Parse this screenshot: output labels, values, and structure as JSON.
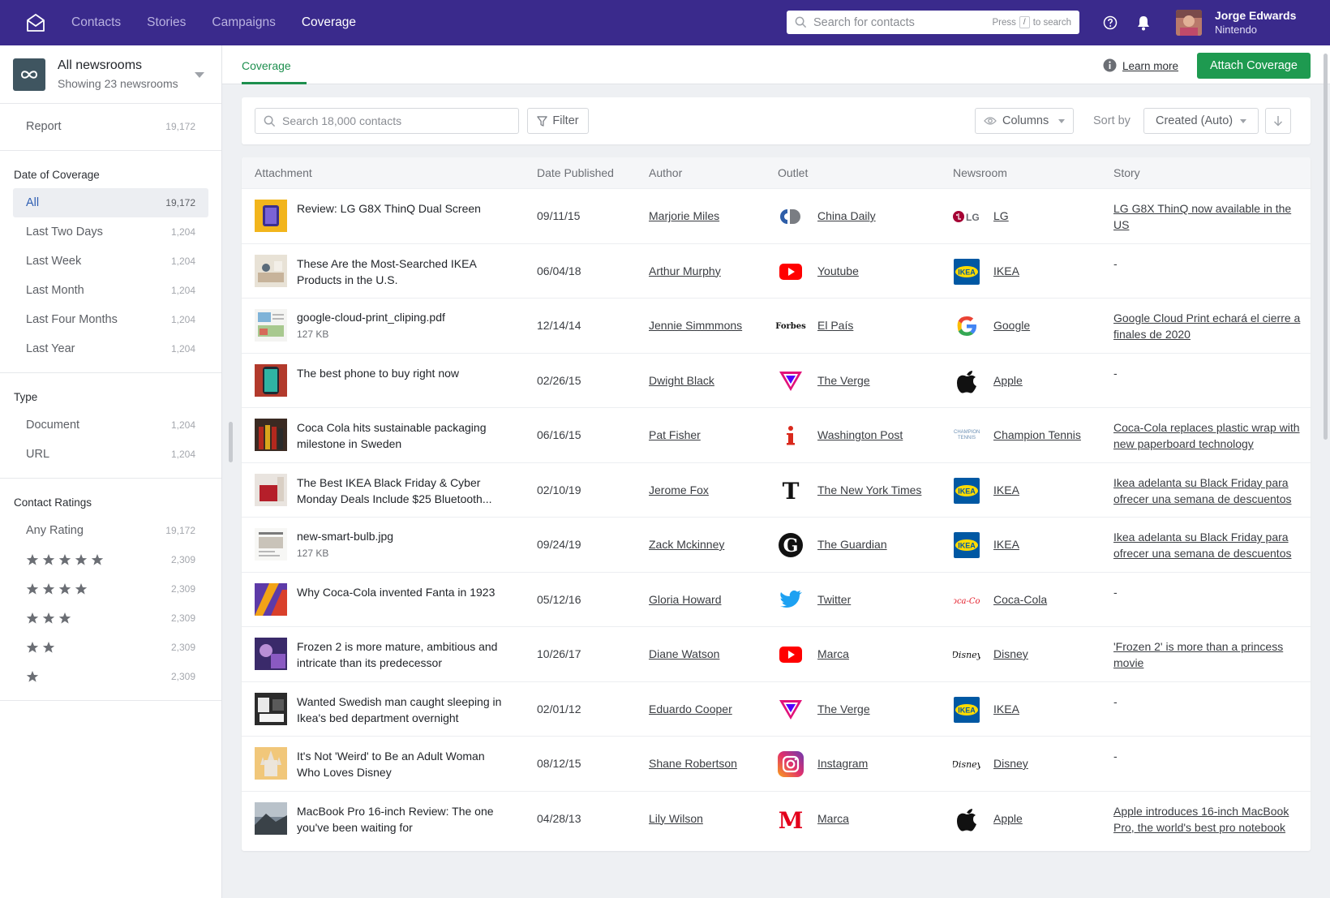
{
  "topbar": {
    "nav": [
      "Contacts",
      "Stories",
      "Campaigns",
      "Coverage"
    ],
    "active_nav": "Coverage",
    "search_placeholder": "Search for contacts",
    "search_hint_prefix": "Press",
    "search_hint_key": "/",
    "search_hint_suffix": "to search",
    "user_name": "Jorge Edwards",
    "user_org": "Nintendo",
    "brand_color": "#3a2a8c"
  },
  "sidebar": {
    "newsroom_title": "All newsrooms",
    "newsroom_sub": "Showing 23 newsrooms",
    "report": {
      "label": "Report",
      "count": "19,172"
    },
    "date_heading": "Date of Coverage",
    "date_items": [
      {
        "label": "All",
        "count": "19,172",
        "active": true
      },
      {
        "label": "Last Two Days",
        "count": "1,204"
      },
      {
        "label": "Last Week",
        "count": "1,204"
      },
      {
        "label": "Last Month",
        "count": "1,204"
      },
      {
        "label": "Last Four Months",
        "count": "1,204"
      },
      {
        "label": "Last Year",
        "count": "1,204"
      }
    ],
    "type_heading": "Type",
    "type_items": [
      {
        "label": "Document",
        "count": "1,204"
      },
      {
        "label": "URL",
        "count": "1,204"
      }
    ],
    "ratings_heading": "Contact Ratings",
    "any_rating": {
      "label": "Any Rating",
      "count": "19,172"
    },
    "rating_items": [
      {
        "stars": 5,
        "count": "2,309"
      },
      {
        "stars": 4,
        "count": "2,309"
      },
      {
        "stars": 3,
        "count": "2,309"
      },
      {
        "stars": 2,
        "count": "2,309"
      },
      {
        "stars": 1,
        "count": "2,309"
      }
    ]
  },
  "content": {
    "tab": "Coverage",
    "learn_more": "Learn more",
    "attach_button": "Attach Coverage",
    "accent_color": "#1e9a50"
  },
  "filters": {
    "search_placeholder": "Search 18,000 contacts",
    "filter_label": "Filter",
    "columns_label": "Columns",
    "sort_label": "Sort by",
    "sort_value": "Created (Auto)"
  },
  "table": {
    "headers": [
      "Attachment",
      "Date Published",
      "Author",
      "Outlet",
      "Newsroom",
      "Story"
    ],
    "rows": [
      {
        "title": "Review: LG G8X ThinQ Dual Screen",
        "size": "",
        "thumb": "phone-yellow",
        "date": "09/11/15",
        "author": "Marjorie Miles",
        "outlet": "China Daily",
        "outlet_icon": "china-daily-logo",
        "newsroom": "LG",
        "newsroom_icon": "lg-logo",
        "story": "LG G8X ThinQ now available in the US"
      },
      {
        "title": "These Are the Most-Searched IKEA Products in the U.S.",
        "size": "",
        "thumb": "room",
        "date": "06/04/18",
        "author": "Arthur Murphy",
        "outlet": "Youtube",
        "outlet_icon": "youtube-logo",
        "newsroom": "IKEA",
        "newsroom_icon": "ikea-logo",
        "story": "-"
      },
      {
        "title": "google-cloud-print_cliping.pdf",
        "size": "127 KB",
        "thumb": "doc",
        "date": "12/14/14",
        "author": "Jennie Simmmons",
        "outlet": "El País",
        "outlet_icon": "forbes-logo",
        "outlet_icon_text": "Forbes",
        "newsroom": "Google",
        "newsroom_icon": "google-logo",
        "story": "Google Cloud Print echará el cierre a finales de 2020"
      },
      {
        "title": "The best phone to buy right now",
        "size": "",
        "thumb": "phone-red",
        "date": "02/26/15",
        "author": "Dwight Black",
        "outlet": "The Verge",
        "outlet_icon": "verge-logo",
        "newsroom": "Apple",
        "newsroom_icon": "apple-logo",
        "story": "-"
      },
      {
        "title": "Coca Cola hits sustainable packaging milestone in Sweden",
        "size": "",
        "thumb": "bottles",
        "date": "06/16/15",
        "author": "Pat Fisher",
        "outlet": "Washington Post",
        "outlet_icon": "independent-logo",
        "newsroom": "Champion Tennis",
        "newsroom_icon": "champion-tennis-logo",
        "newsroom_icon_text": "CHAMPION TENNIS",
        "story": "Coca-Cola replaces plastic wrap with new paperboard technology"
      },
      {
        "title": "The Best IKEA Black Friday & Cyber Monday Deals Include $25 Bluetooth...",
        "size": "",
        "thumb": "red-chair",
        "date": "02/10/19",
        "author": "Jerome Fox",
        "outlet": "The New York Times",
        "outlet_icon": "nyt-logo",
        "newsroom": "IKEA",
        "newsroom_icon": "ikea-logo",
        "story": "Ikea adelanta su Black Friday para ofrecer una semana de descuentos"
      },
      {
        "title": "new-smart-bulb.jpg",
        "size": "127 KB",
        "thumb": "doc2",
        "date": "09/24/19",
        "author": "Zack Mckinney",
        "outlet": "The Guardian",
        "outlet_icon": "guardian-logo",
        "newsroom": "IKEA",
        "newsroom_icon": "ikea-logo",
        "story": "Ikea adelanta su Black Friday para ofrecer una semana de descuentos"
      },
      {
        "title": "Why Coca-Cola invented Fanta in 1923",
        "size": "",
        "thumb": "colorful",
        "date": "05/12/16",
        "author": "Gloria Howard",
        "outlet": "Twitter",
        "outlet_icon": "twitter-logo",
        "newsroom": "Coca-Cola",
        "newsroom_icon": "coca-cola-logo",
        "story": "-"
      },
      {
        "title": "Frozen 2 is more mature, ambitious and intricate than its predecessor",
        "size": "",
        "thumb": "purple",
        "date": "10/26/17",
        "author": "Diane Watson",
        "outlet": "Marca",
        "outlet_icon": "youtube-logo",
        "newsroom": "Disney",
        "newsroom_icon": "disney-logo",
        "story": "'Frozen 2' is more than a princess movie"
      },
      {
        "title": "Wanted Swedish man caught sleeping in Ikea's bed department overnight",
        "size": "",
        "thumb": "bedroom",
        "date": "02/01/12",
        "author": "Eduardo Cooper",
        "outlet": "The Verge",
        "outlet_icon": "verge-logo",
        "newsroom": "IKEA",
        "newsroom_icon": "ikea-logo",
        "story": "-"
      },
      {
        "title": "It's Not 'Weird' to Be an Adult Woman Who Loves Disney",
        "size": "",
        "thumb": "castle",
        "date": "08/12/15",
        "author": "Shane Robertson",
        "outlet": "Instagram",
        "outlet_icon": "instagram-logo",
        "newsroom": "Disney",
        "newsroom_icon": "disney-logo",
        "story": "-"
      },
      {
        "title": "MacBook Pro 16-inch Review: The one you've been waiting for",
        "size": "",
        "thumb": "landscape",
        "date": "04/28/13",
        "author": "Lily Wilson",
        "outlet": "Marca",
        "outlet_icon": "marca-logo",
        "newsroom": "Apple",
        "newsroom_icon": "apple-logo",
        "story": "Apple introduces 16-inch MacBook Pro, the world's best pro notebook"
      }
    ]
  }
}
